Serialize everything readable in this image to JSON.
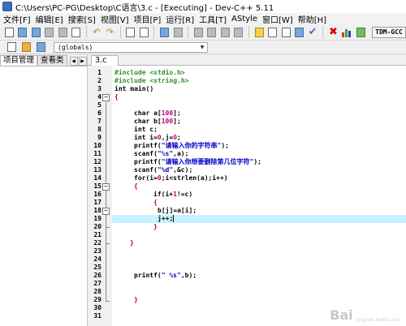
{
  "window": {
    "title": "C:\\Users\\PC-PG\\Desktop\\C语言\\3.c - [Executing] - Dev-C++ 5.11"
  },
  "menu": [
    "文件[F]",
    "编辑[E]",
    "搜索[S]",
    "视图[V]",
    "项目[P]",
    "运行[R]",
    "工具[T]",
    "AStyle",
    "窗口[W]",
    "帮助[H]"
  ],
  "toolbar": {
    "compiler": "TDM-GCC"
  },
  "toolbar2": {
    "scope": "(globals)"
  },
  "left_panel": {
    "tabs": [
      "项目管理",
      "查看类"
    ]
  },
  "editor": {
    "file_tab": "3.c",
    "line_numbers": [
      "1",
      "2",
      "3",
      "4",
      "5",
      "6",
      "7",
      "8",
      "9",
      "10",
      "11",
      "12",
      "13",
      "14",
      "15",
      "16",
      "17",
      "18",
      "19",
      "20",
      "21",
      "22",
      "23",
      "24",
      "25",
      "26",
      "27",
      "28",
      "29",
      "30",
      "31"
    ],
    "code": {
      "l1": "#include <stdio.h>",
      "l2": "#include <string.h>",
      "l3": "int main()",
      "l4": "{",
      "l6_kw": "char",
      "l6_rest": " a[",
      "l6_num": "100",
      "l6_end": "];",
      "l7_kw": "char",
      "l7_rest": " b[",
      "l7_num": "100",
      "l7_end": "];",
      "l8_kw": "int",
      "l8_rest": " c;",
      "l9_kw": "int",
      "l9_rest": " i=",
      "l9_n1": "0",
      "l9_mid": ",j=",
      "l9_n2": "0",
      "l9_end": ";",
      "l10_fn": "printf(",
      "l10_str": "\"请输入你的字符串\"",
      "l10_end": ");",
      "l11_fn": "scanf(",
      "l11_str": "\"%s\"",
      "l11_end": ",a);",
      "l12_fn": "printf(",
      "l12_str": "\"请输入你想要删除第几位字符\"",
      "l12_end": ");",
      "l13_fn": "scanf(",
      "l13_str": "\"%d\"",
      "l13_end": ",&c);",
      "l14_kw": "for",
      "l14_rest": "(i=",
      "l14_n": "0",
      "l14_end": ";i<strlen(a);i++)",
      "l15": "{",
      "l16_kw": "if",
      "l16_rest": "(i+",
      "l16_n": "1",
      "l16_end": "!=c)",
      "l17": "{",
      "l18": "b[j]=a[i];",
      "l19": "j++;",
      "l20": "}",
      "l22": "}",
      "l25_fn": "printf(",
      "l25_str": "\" %s\"",
      "l25_end": ",b);",
      "l29": "}"
    }
  },
  "watermark": {
    "logo": "Bai",
    "text": "jingyan.baidu.com"
  }
}
